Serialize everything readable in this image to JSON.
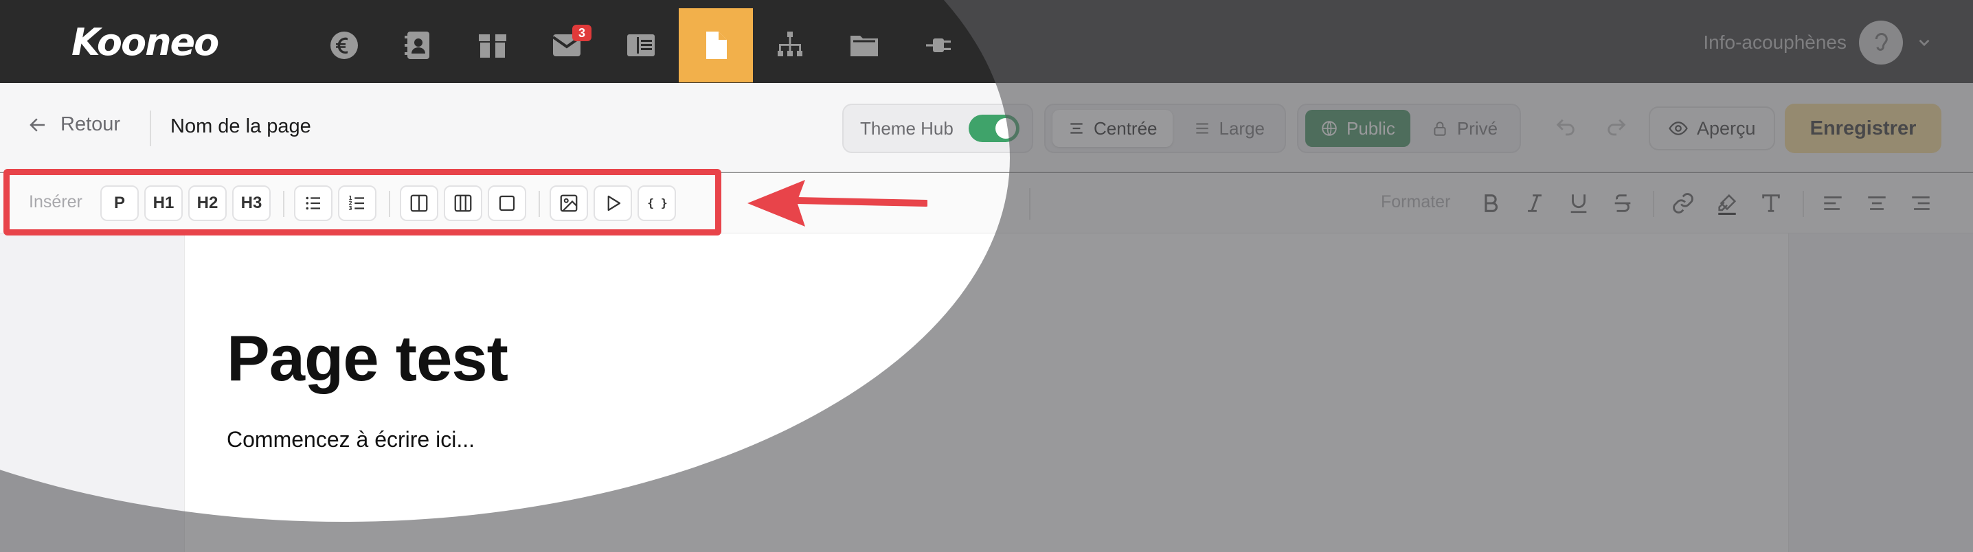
{
  "topnav": {
    "logo": "Kooneo",
    "icons": [
      {
        "name": "euro-icon"
      },
      {
        "name": "contacts-icon"
      },
      {
        "name": "box-icon"
      },
      {
        "name": "mail-icon",
        "badge": "3"
      },
      {
        "name": "layout-icon"
      },
      {
        "name": "document-icon",
        "active": true
      },
      {
        "name": "sitemap-icon"
      },
      {
        "name": "folder-icon"
      },
      {
        "name": "plug-icon"
      }
    ],
    "account_name": "Info-acouphènes"
  },
  "header": {
    "back_label": "Retour",
    "page_name": "Nom de la page",
    "theme_hub_label": "Theme Hub",
    "theme_hub_on": true,
    "width_options": [
      "Centrée",
      "Large"
    ],
    "width_selected": "Centrée",
    "visibility_options": [
      "Public",
      "Privé"
    ],
    "visibility_selected": "Public",
    "preview_label": "Aperçu",
    "save_label": "Enregistrer"
  },
  "toolbar": {
    "insert_label": "Insérer",
    "insert_buttons": [
      "P",
      "H1",
      "H2",
      "H3"
    ],
    "format_label": "Formater"
  },
  "editor": {
    "title": "Page test",
    "placeholder": "Commencez à écrire ici..."
  },
  "colors": {
    "nav_bg": "#2a2a2a",
    "active_nav": "#f2b04b",
    "public_green": "#3a8c5a",
    "save_bg": "#f4d88f",
    "annotation_red": "#e8444a"
  }
}
